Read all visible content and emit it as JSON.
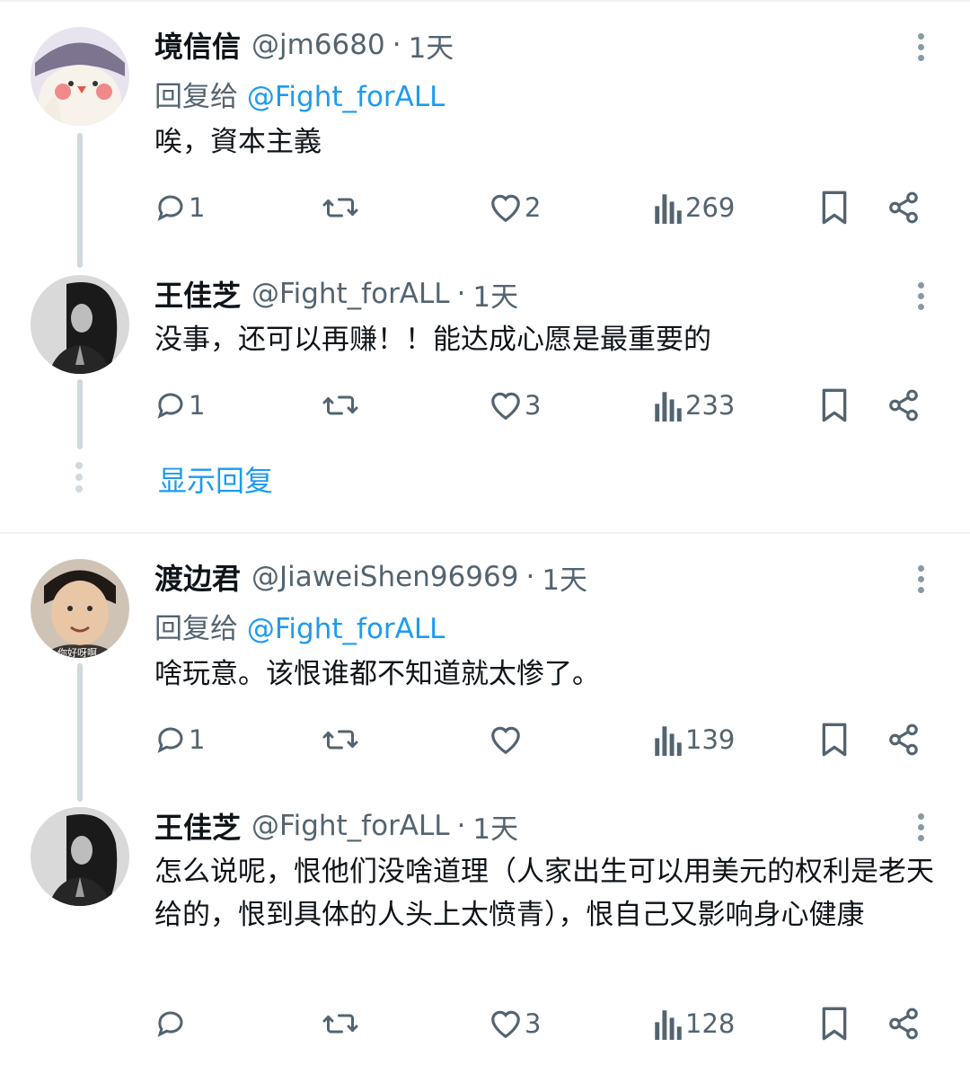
{
  "colors": {
    "accent": "#1d9bf0",
    "secondary": "#536471",
    "text": "#0f1419"
  },
  "icons": {
    "reply": "speech-bubble-icon",
    "retweet": "retweet-arrows-icon",
    "like": "heart-icon",
    "views": "bar-chart-icon",
    "bookmark": "bookmark-icon",
    "share": "share-icon",
    "more": "vertical-ellipsis-icon"
  },
  "tweets": [
    {
      "name": "境信信",
      "handle": "@jm6680",
      "sep": "·",
      "time": "1天",
      "reply_prefix": "回复给",
      "reply_to": "@Fight_forALL",
      "text": "唉，資本主義",
      "replies": "1",
      "likes": "2",
      "views": "269"
    },
    {
      "name": "王佳芝",
      "handle": "@Fight_forALL",
      "sep": "·",
      "time": "1天",
      "text": "没事，还可以再赚！！能达成心愿是最重要的",
      "replies": "1",
      "likes": "3",
      "views": "233"
    },
    {
      "name": "渡边君",
      "handle": "@JiaweiShen96969",
      "sep": "·",
      "time": "1天",
      "reply_prefix": "回复给",
      "reply_to": "@Fight_forALL",
      "text": "啥玩意。该恨谁都不知道就太惨了。",
      "avatar_caption": "你好呀啊",
      "replies": "1",
      "likes": "",
      "views": "139"
    },
    {
      "name": "王佳芝",
      "handle": "@Fight_forALL",
      "sep": "·",
      "time": "1天",
      "text": "怎么说呢，恨他们没啥道理（人家出生可以用美元的权利是老天给的，恨到具体的人头上太愤青），恨自己又影响身心健康",
      "replies": "",
      "likes": "3",
      "views": "128"
    }
  ],
  "show_replies": "显示回复"
}
